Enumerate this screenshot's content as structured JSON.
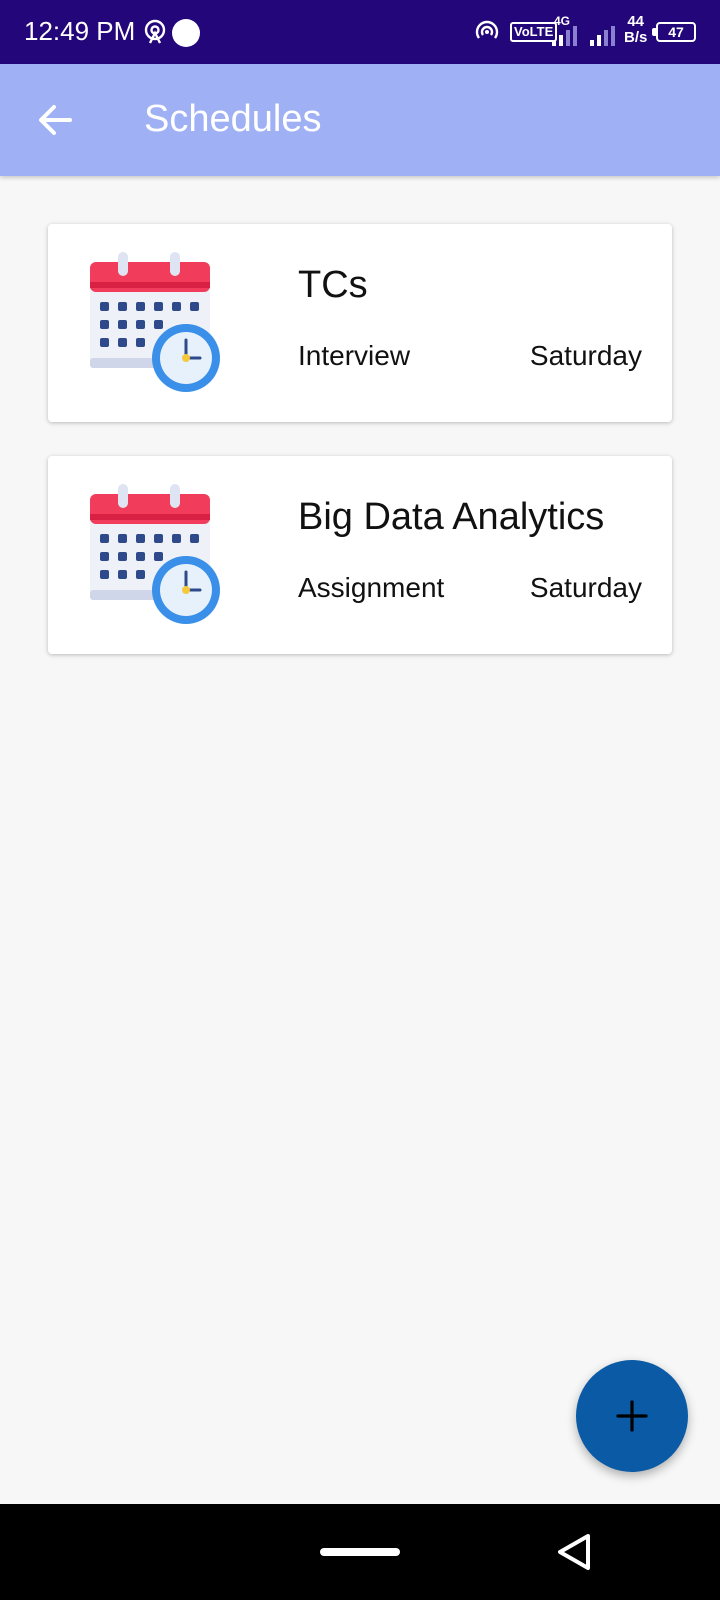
{
  "status_bar": {
    "time": "12:49 PM",
    "network_label": "VoLTE",
    "network_type": "4G",
    "speed_value": "44",
    "speed_unit": "B/s",
    "battery": "47"
  },
  "app_bar": {
    "title": "Schedules"
  },
  "schedules": [
    {
      "title": "TCs",
      "type": "Interview",
      "day": "Saturday"
    },
    {
      "title": "Big Data Analytics",
      "type": "Assignment",
      "day": "Saturday"
    }
  ],
  "colors": {
    "status_bar": "#23077a",
    "app_bar": "#9fb1f4",
    "fab": "#0a5aa6",
    "background": "#f7f7f7"
  },
  "icons": {
    "back": "arrow-left-icon",
    "schedule": "calendar-clock-icon",
    "add": "plus-icon"
  }
}
